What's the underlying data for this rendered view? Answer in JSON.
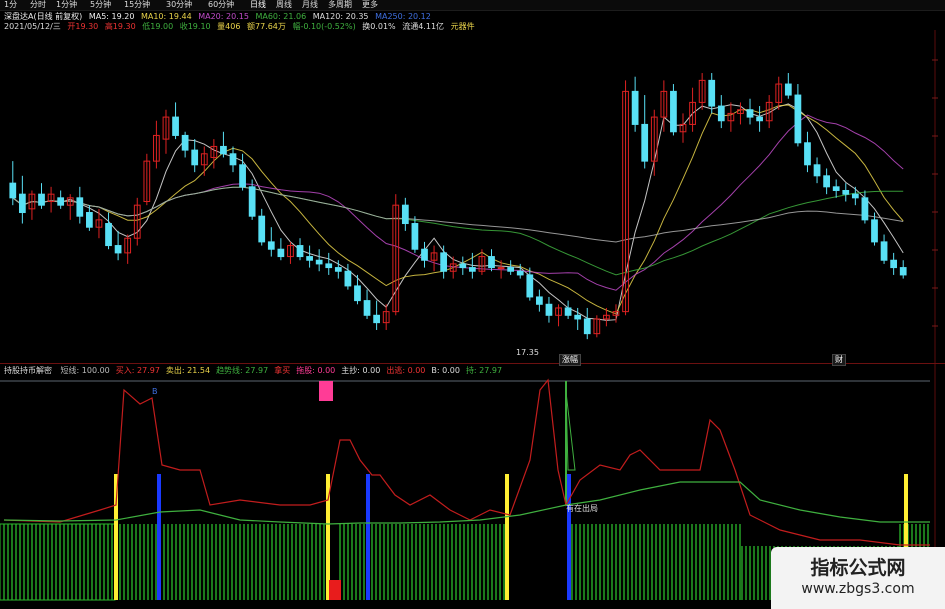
{
  "colors": {
    "bg": "#000000",
    "up": "#d22",
    "down": "#59e0f5",
    "ma5": "#e6e6e6",
    "ma10": "#e9d34a",
    "ma20": "#c04bc8",
    "ma60": "#3fb03f",
    "ma120": "#b0b0b0",
    "yellow": "#ffee33",
    "blue": "#1a3aff",
    "pink": "#ff3c96",
    "green": "#2bb82b"
  },
  "toolbar": {
    "items": [
      "1分",
      "分时",
      "1分钟",
      "5分钟",
      "15分钟",
      "30分钟",
      "60分钟",
      "日线",
      "周线",
      "月线",
      "多周期",
      "更多"
    ],
    "selected": "日线"
  },
  "header": {
    "title": "深盘达A(日线 前复权)",
    "ma5": "MA5: 19.20",
    "ma10": "MA10: 19.44",
    "ma20": "MA20: 20.15",
    "ma60": "MA60: 21.06",
    "ma120": "MA120: 20.35",
    "extra": "MA250: 20.12"
  },
  "quote": {
    "date": "2021/05/12/三",
    "open": "开19.30",
    "high": "高19.30",
    "low": "低19.00",
    "close": "收19.10",
    "vol": "量406",
    "amount": "额77.64万",
    "change": "幅-0.10(-0.52%)",
    "turnover": "换0.01%",
    "float": "流通4.11亿",
    "sector": "元器件"
  },
  "indicator": {
    "name": "持股持币解密",
    "items": [
      {
        "label": "短线: 100.00",
        "color": "#bbbbbb"
      },
      {
        "label": "买入: 27.97",
        "color": "#e33"
      },
      {
        "label": "卖出: 21.54",
        "color": "#e9d34a"
      },
      {
        "label": "趋势线: 27.97",
        "color": "#3fb03f"
      },
      {
        "label": "拿买",
        "color": "#e33"
      },
      {
        "label": "拖股: 0.00",
        "color": "#ff3c96"
      },
      {
        "label": "主抄: 0.00",
        "color": "#ddd"
      },
      {
        "label": "出逃: 0.00",
        "color": "#e33"
      },
      {
        "label": "B: 0.00",
        "color": "#ddd"
      },
      {
        "label": "持: 27.97",
        "color": "#3fb03f"
      }
    ]
  },
  "price_labels": {
    "low": "17.35",
    "tag1": "涨幅",
    "tag2": "财",
    "marker_b": "B",
    "note": "有在出局"
  },
  "watermark": {
    "line1": "指标公式网",
    "line2": "www.zbgs3.com"
  },
  "chart_data": {
    "type": "candlestick",
    "title": "深盘达A(日线 前复权)",
    "xlabel": "",
    "ylabel": "",
    "candles_note": "approx. daily OHLC read from pixel positions",
    "candles": [
      {
        "o": 21.6,
        "h": 22.2,
        "l": 21.0,
        "c": 21.2
      },
      {
        "o": 21.3,
        "h": 21.8,
        "l": 20.5,
        "c": 20.8
      },
      {
        "o": 20.9,
        "h": 21.4,
        "l": 20.6,
        "c": 21.3
      },
      {
        "o": 21.3,
        "h": 21.6,
        "l": 20.9,
        "c": 21.0
      },
      {
        "o": 21.1,
        "h": 21.5,
        "l": 20.8,
        "c": 21.3
      },
      {
        "o": 21.2,
        "h": 21.4,
        "l": 20.9,
        "c": 21.0
      },
      {
        "o": 21.0,
        "h": 21.3,
        "l": 20.6,
        "c": 21.2
      },
      {
        "o": 21.2,
        "h": 21.5,
        "l": 20.5,
        "c": 20.7
      },
      {
        "o": 20.8,
        "h": 21.0,
        "l": 20.3,
        "c": 20.4
      },
      {
        "o": 20.4,
        "h": 20.9,
        "l": 20.1,
        "c": 20.6
      },
      {
        "o": 20.5,
        "h": 20.8,
        "l": 19.8,
        "c": 19.9
      },
      {
        "o": 19.9,
        "h": 20.3,
        "l": 19.5,
        "c": 19.7
      },
      {
        "o": 19.7,
        "h": 20.2,
        "l": 19.4,
        "c": 20.1
      },
      {
        "o": 20.1,
        "h": 21.2,
        "l": 19.9,
        "c": 21.0
      },
      {
        "o": 21.1,
        "h": 22.4,
        "l": 21.0,
        "c": 22.2
      },
      {
        "o": 22.2,
        "h": 23.3,
        "l": 22.0,
        "c": 22.9
      },
      {
        "o": 22.8,
        "h": 23.6,
        "l": 22.4,
        "c": 23.4
      },
      {
        "o": 23.4,
        "h": 23.8,
        "l": 22.8,
        "c": 22.9
      },
      {
        "o": 22.9,
        "h": 23.0,
        "l": 22.3,
        "c": 22.5
      },
      {
        "o": 22.5,
        "h": 22.8,
        "l": 21.9,
        "c": 22.1
      },
      {
        "o": 22.1,
        "h": 22.6,
        "l": 21.8,
        "c": 22.4
      },
      {
        "o": 22.3,
        "h": 22.8,
        "l": 22.0,
        "c": 22.6
      },
      {
        "o": 22.6,
        "h": 23.0,
        "l": 22.3,
        "c": 22.4
      },
      {
        "o": 22.4,
        "h": 22.6,
        "l": 21.9,
        "c": 22.1
      },
      {
        "o": 22.1,
        "h": 22.4,
        "l": 21.4,
        "c": 21.5
      },
      {
        "o": 21.5,
        "h": 21.7,
        "l": 20.6,
        "c": 20.7
      },
      {
        "o": 20.7,
        "h": 20.9,
        "l": 19.9,
        "c": 20.0
      },
      {
        "o": 20.0,
        "h": 20.4,
        "l": 19.6,
        "c": 19.8
      },
      {
        "o": 19.8,
        "h": 20.1,
        "l": 19.5,
        "c": 19.6
      },
      {
        "o": 19.6,
        "h": 20.0,
        "l": 19.4,
        "c": 19.9
      },
      {
        "o": 19.9,
        "h": 20.1,
        "l": 19.5,
        "c": 19.6
      },
      {
        "o": 19.6,
        "h": 19.9,
        "l": 19.3,
        "c": 19.5
      },
      {
        "o": 19.5,
        "h": 19.8,
        "l": 19.2,
        "c": 19.4
      },
      {
        "o": 19.4,
        "h": 19.7,
        "l": 19.1,
        "c": 19.3
      },
      {
        "o": 19.3,
        "h": 19.5,
        "l": 19.0,
        "c": 19.2
      },
      {
        "o": 19.2,
        "h": 19.4,
        "l": 18.7,
        "c": 18.8
      },
      {
        "o": 18.8,
        "h": 19.1,
        "l": 18.3,
        "c": 18.4
      },
      {
        "o": 18.4,
        "h": 18.7,
        "l": 17.9,
        "c": 18.0
      },
      {
        "o": 18.0,
        "h": 18.4,
        "l": 17.6,
        "c": 17.8
      },
      {
        "o": 17.8,
        "h": 18.3,
        "l": 17.6,
        "c": 18.1
      },
      {
        "o": 18.1,
        "h": 21.3,
        "l": 18.0,
        "c": 21.0
      },
      {
        "o": 21.0,
        "h": 21.2,
        "l": 20.3,
        "c": 20.5
      },
      {
        "o": 20.5,
        "h": 20.7,
        "l": 19.7,
        "c": 19.8
      },
      {
        "o": 19.8,
        "h": 20.0,
        "l": 19.3,
        "c": 19.5
      },
      {
        "o": 19.5,
        "h": 19.9,
        "l": 19.2,
        "c": 19.7
      },
      {
        "o": 19.7,
        "h": 19.9,
        "l": 19.0,
        "c": 19.2
      },
      {
        "o": 19.2,
        "h": 19.6,
        "l": 19.0,
        "c": 19.4
      },
      {
        "o": 19.4,
        "h": 19.6,
        "l": 19.1,
        "c": 19.3
      },
      {
        "o": 19.3,
        "h": 19.7,
        "l": 19.0,
        "c": 19.2
      },
      {
        "o": 19.2,
        "h": 19.8,
        "l": 19.1,
        "c": 19.6
      },
      {
        "o": 19.6,
        "h": 19.8,
        "l": 19.2,
        "c": 19.3
      },
      {
        "o": 19.3,
        "h": 19.5,
        "l": 19.0,
        "c": 19.3
      },
      {
        "o": 19.3,
        "h": 19.5,
        "l": 19.1,
        "c": 19.2
      },
      {
        "o": 19.2,
        "h": 19.4,
        "l": 19.0,
        "c": 19.1
      },
      {
        "o": 19.1,
        "h": 19.3,
        "l": 18.4,
        "c": 18.5
      },
      {
        "o": 18.5,
        "h": 18.7,
        "l": 18.1,
        "c": 18.3
      },
      {
        "o": 18.3,
        "h": 18.5,
        "l": 17.8,
        "c": 18.0
      },
      {
        "o": 18.0,
        "h": 18.3,
        "l": 17.7,
        "c": 18.2
      },
      {
        "o": 18.2,
        "h": 18.4,
        "l": 17.9,
        "c": 18.0
      },
      {
        "o": 18.0,
        "h": 18.2,
        "l": 17.6,
        "c": 17.9
      },
      {
        "o": 17.9,
        "h": 18.2,
        "l": 17.35,
        "c": 17.5
      },
      {
        "o": 17.5,
        "h": 18.0,
        "l": 17.4,
        "c": 17.9
      },
      {
        "o": 17.9,
        "h": 18.2,
        "l": 17.7,
        "c": 18.0
      },
      {
        "o": 18.0,
        "h": 18.3,
        "l": 17.8,
        "c": 18.1
      },
      {
        "o": 18.1,
        "h": 24.4,
        "l": 18.0,
        "c": 24.1
      },
      {
        "o": 24.1,
        "h": 24.5,
        "l": 23.0,
        "c": 23.2
      },
      {
        "o": 23.2,
        "h": 24.0,
        "l": 22.0,
        "c": 22.2
      },
      {
        "o": 22.2,
        "h": 23.6,
        "l": 21.8,
        "c": 23.4
      },
      {
        "o": 23.4,
        "h": 24.4,
        "l": 23.0,
        "c": 24.1
      },
      {
        "o": 24.1,
        "h": 24.3,
        "l": 22.9,
        "c": 23.0
      },
      {
        "o": 23.0,
        "h": 23.5,
        "l": 22.7,
        "c": 23.2
      },
      {
        "o": 23.2,
        "h": 24.2,
        "l": 23.0,
        "c": 23.8
      },
      {
        "o": 23.8,
        "h": 24.6,
        "l": 23.6,
        "c": 24.4
      },
      {
        "o": 24.4,
        "h": 24.6,
        "l": 23.5,
        "c": 23.7
      },
      {
        "o": 23.7,
        "h": 24.0,
        "l": 23.1,
        "c": 23.3
      },
      {
        "o": 23.3,
        "h": 23.8,
        "l": 23.0,
        "c": 23.5
      },
      {
        "o": 23.5,
        "h": 23.8,
        "l": 23.2,
        "c": 23.6
      },
      {
        "o": 23.6,
        "h": 23.9,
        "l": 23.2,
        "c": 23.4
      },
      {
        "o": 23.4,
        "h": 23.7,
        "l": 23.0,
        "c": 23.3
      },
      {
        "o": 23.3,
        "h": 24.0,
        "l": 23.1,
        "c": 23.8
      },
      {
        "o": 23.8,
        "h": 24.5,
        "l": 23.6,
        "c": 24.3
      },
      {
        "o": 24.3,
        "h": 24.6,
        "l": 23.9,
        "c": 24.0
      },
      {
        "o": 24.0,
        "h": 24.3,
        "l": 22.6,
        "c": 22.7
      },
      {
        "o": 22.7,
        "h": 23.0,
        "l": 21.9,
        "c": 22.1
      },
      {
        "o": 22.1,
        "h": 22.3,
        "l": 21.6,
        "c": 21.8
      },
      {
        "o": 21.8,
        "h": 22.0,
        "l": 21.3,
        "c": 21.5
      },
      {
        "o": 21.5,
        "h": 21.7,
        "l": 21.2,
        "c": 21.4
      },
      {
        "o": 21.4,
        "h": 21.6,
        "l": 21.1,
        "c": 21.3
      },
      {
        "o": 21.3,
        "h": 21.5,
        "l": 21.0,
        "c": 21.2
      },
      {
        "o": 21.2,
        "h": 21.4,
        "l": 20.5,
        "c": 20.6
      },
      {
        "o": 20.6,
        "h": 20.8,
        "l": 19.9,
        "c": 20.0
      },
      {
        "o": 20.0,
        "h": 20.2,
        "l": 19.4,
        "c": 19.5
      },
      {
        "o": 19.5,
        "h": 19.7,
        "l": 19.1,
        "c": 19.3
      },
      {
        "o": 19.3,
        "h": 19.5,
        "l": 19.0,
        "c": 19.1
      }
    ],
    "ylim": [
      17.0,
      25.5
    ]
  }
}
